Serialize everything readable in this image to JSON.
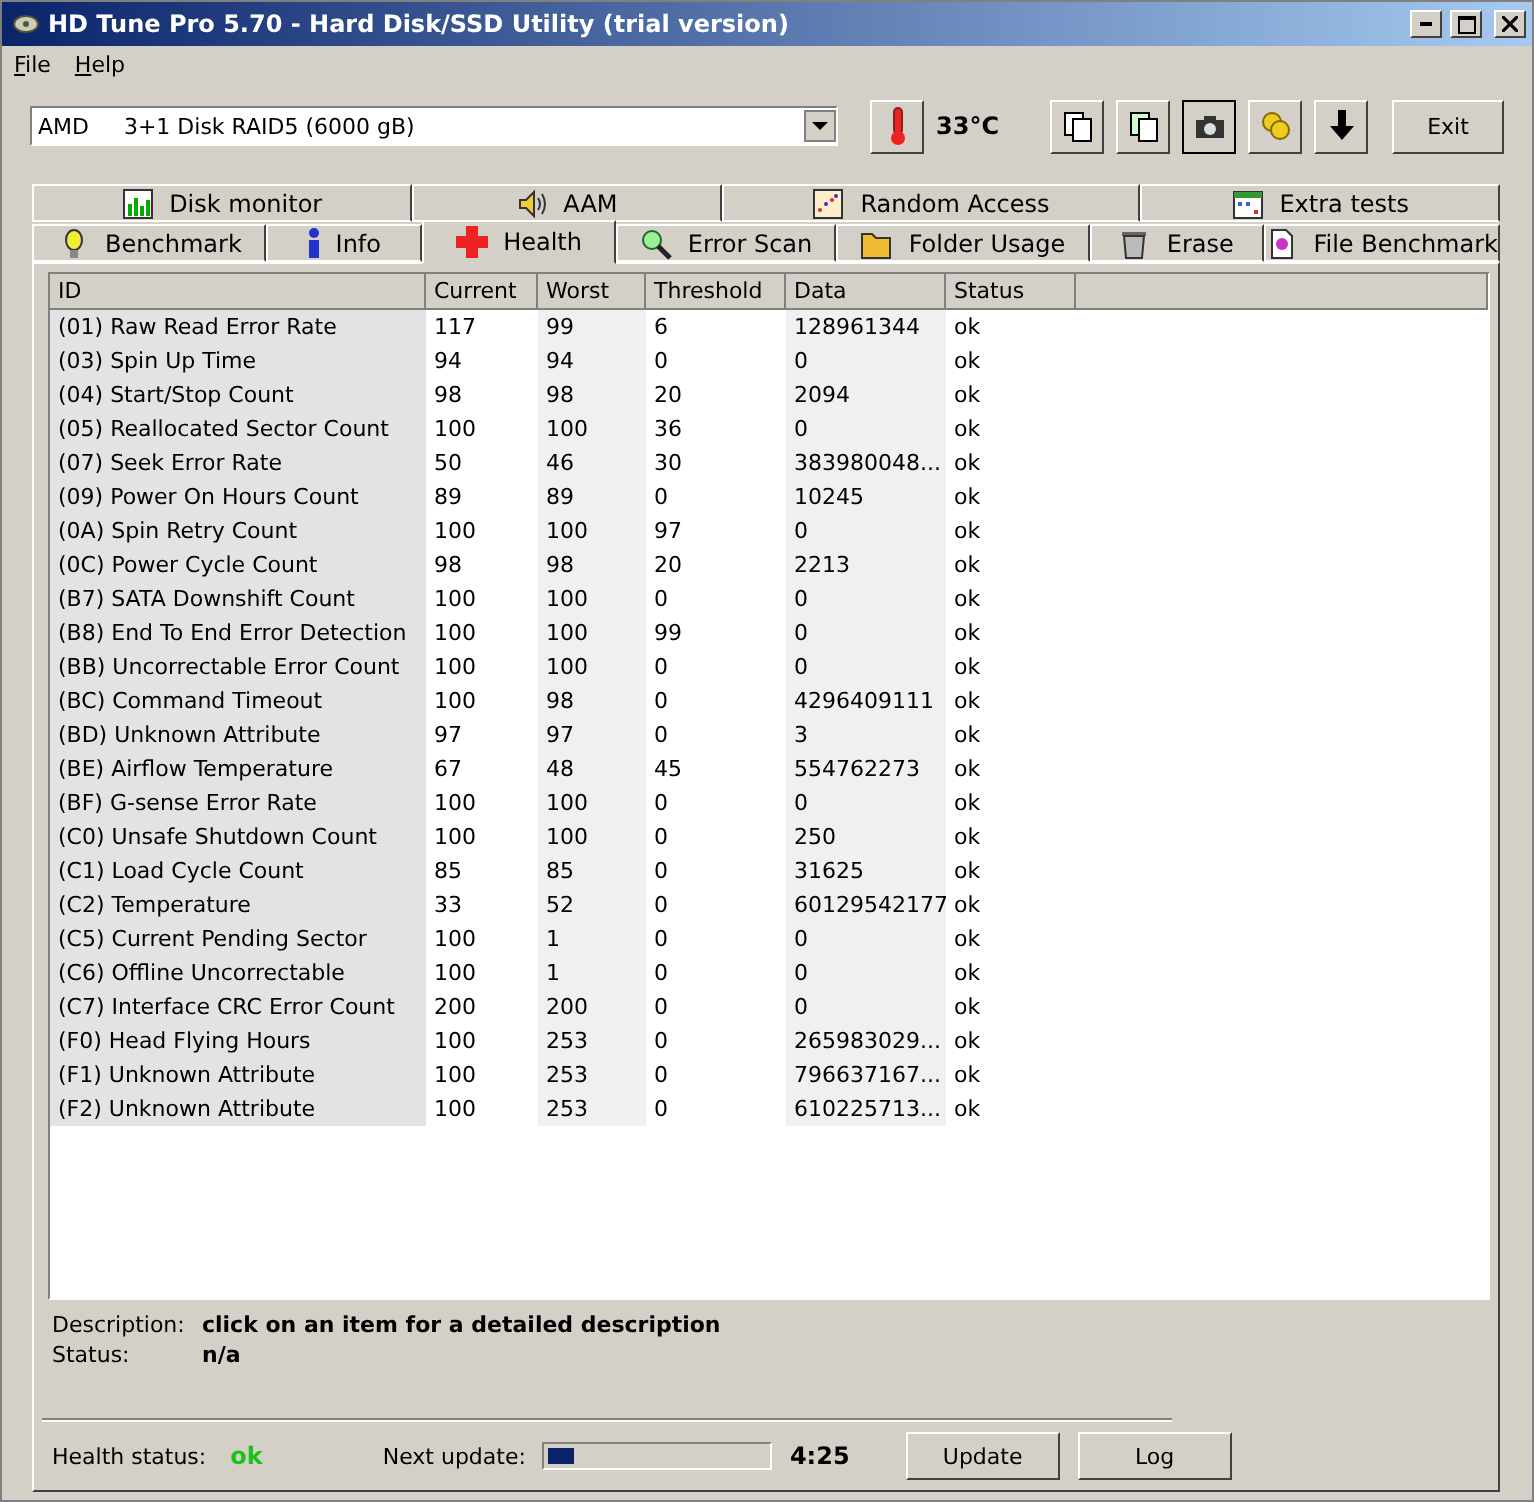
{
  "window": {
    "title": "HD Tune Pro 5.70 - Hard Disk/SSD Utility (trial version)"
  },
  "menu": [
    {
      "label": "File"
    },
    {
      "label": "Help"
    }
  ],
  "drive": {
    "value": "AMD     3+1 Disk RAID5 (6000 gB)"
  },
  "temperature": "33°C",
  "exit_button": "Exit",
  "tabs_top": [
    {
      "label": "Disk monitor",
      "selected": false
    },
    {
      "label": "AAM",
      "selected": false
    },
    {
      "label": "Random Access",
      "selected": false
    },
    {
      "label": "Extra tests",
      "selected": false
    }
  ],
  "tabs_bottom": [
    {
      "label": "Benchmark",
      "selected": false
    },
    {
      "label": "Info",
      "selected": false
    },
    {
      "label": "Health",
      "selected": true
    },
    {
      "label": "Error Scan",
      "selected": false
    },
    {
      "label": "Folder Usage",
      "selected": false
    },
    {
      "label": "Erase",
      "selected": false
    },
    {
      "label": "File Benchmark",
      "selected": false
    }
  ],
  "table": {
    "columns": [
      "ID",
      "Current",
      "Worst",
      "Threshold",
      "Data",
      "Status"
    ],
    "rows": [
      [
        "(01) Raw Read Error Rate",
        "117",
        "99",
        "6",
        "128961344",
        "ok"
      ],
      [
        "(03) Spin Up Time",
        "94",
        "94",
        "0",
        "0",
        "ok"
      ],
      [
        "(04) Start/Stop Count",
        "98",
        "98",
        "20",
        "2094",
        "ok"
      ],
      [
        "(05) Reallocated Sector Count",
        "100",
        "100",
        "36",
        "0",
        "ok"
      ],
      [
        "(07) Seek Error Rate",
        "50",
        "46",
        "30",
        "383980048...",
        "ok"
      ],
      [
        "(09) Power On Hours Count",
        "89",
        "89",
        "0",
        "10245",
        "ok"
      ],
      [
        "(0A) Spin Retry Count",
        "100",
        "100",
        "97",
        "0",
        "ok"
      ],
      [
        "(0C) Power Cycle Count",
        "98",
        "98",
        "20",
        "2213",
        "ok"
      ],
      [
        "(B7) SATA Downshift Count",
        "100",
        "100",
        "0",
        "0",
        "ok"
      ],
      [
        "(B8) End To End Error Detection",
        "100",
        "100",
        "99",
        "0",
        "ok"
      ],
      [
        "(BB) Uncorrectable Error Count",
        "100",
        "100",
        "0",
        "0",
        "ok"
      ],
      [
        "(BC) Command Timeout",
        "100",
        "98",
        "0",
        "4296409111",
        "ok"
      ],
      [
        "(BD) Unknown Attribute",
        "97",
        "97",
        "0",
        "3",
        "ok"
      ],
      [
        "(BE) Airflow Temperature",
        "67",
        "48",
        "45",
        "554762273",
        "ok"
      ],
      [
        "(BF) G-sense Error Rate",
        "100",
        "100",
        "0",
        "0",
        "ok"
      ],
      [
        "(C0) Unsafe Shutdown Count",
        "100",
        "100",
        "0",
        "250",
        "ok"
      ],
      [
        "(C1) Load Cycle Count",
        "85",
        "85",
        "0",
        "31625",
        "ok"
      ],
      [
        "(C2) Temperature",
        "33",
        "52",
        "0",
        "60129542177",
        "ok"
      ],
      [
        "(C5) Current Pending Sector",
        "100",
        "1",
        "0",
        "0",
        "ok"
      ],
      [
        "(C6) Offline Uncorrectable",
        "100",
        "1",
        "0",
        "0",
        "ok"
      ],
      [
        "(C7) Interface CRC Error Count",
        "200",
        "200",
        "0",
        "0",
        "ok"
      ],
      [
        "(F0) Head Flying Hours",
        "100",
        "253",
        "0",
        "265983029...",
        "ok"
      ],
      [
        "(F1) Unknown Attribute",
        "100",
        "253",
        "0",
        "796637167...",
        "ok"
      ],
      [
        "(F2) Unknown Attribute",
        "100",
        "253",
        "0",
        "610225713...",
        "ok"
      ]
    ]
  },
  "details": [
    {
      "label": "Description:",
      "value": "click on an item for a detailed description"
    },
    {
      "label": "Status:",
      "value": "n/a"
    }
  ],
  "health_status": {
    "label": "Health status:",
    "value": "ok"
  },
  "next_update": {
    "label": "Next update:",
    "level": 0.12,
    "time": "4:25"
  },
  "buttons": [
    "Update",
    "Log"
  ]
}
